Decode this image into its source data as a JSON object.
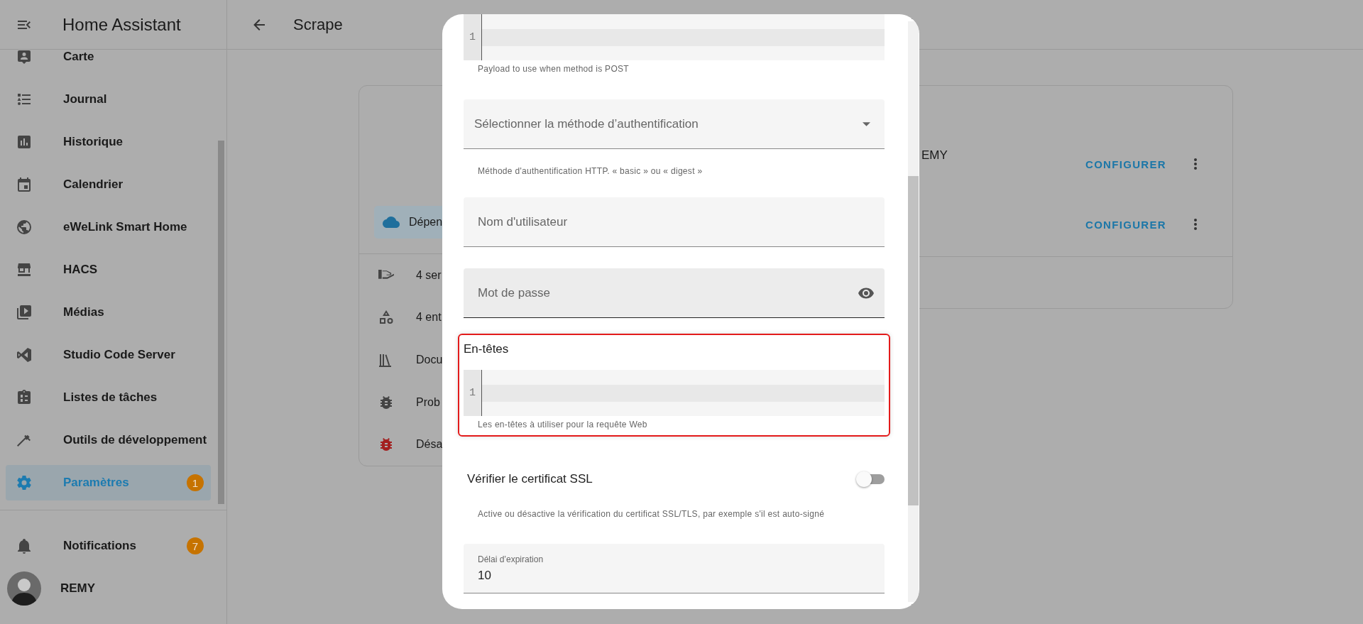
{
  "sidebar": {
    "title": "Home Assistant",
    "items": [
      {
        "label": "Carte",
        "selected": false
      },
      {
        "label": "Journal",
        "selected": false
      },
      {
        "label": "Historique",
        "selected": false
      },
      {
        "label": "Calendrier",
        "selected": false
      },
      {
        "label": "eWeLink Smart Home",
        "selected": false
      },
      {
        "label": "HACS",
        "selected": false
      },
      {
        "label": "Médias",
        "selected": false
      },
      {
        "label": "Studio Code Server",
        "selected": false
      },
      {
        "label": "Listes de tâches",
        "selected": false
      },
      {
        "label": "Outils de développement",
        "selected": false
      },
      {
        "label": "Paramètres",
        "selected": true,
        "badge": "1"
      }
    ],
    "notifications": {
      "label": "Notifications",
      "badge": "7"
    },
    "user": {
      "name": "REMY"
    }
  },
  "header": {
    "title": "Scrape"
  },
  "integration_card": {
    "chip": "Dépen",
    "links": [
      {
        "label": "4 ser"
      },
      {
        "label": "4 ent"
      },
      {
        "label": "Docu"
      },
      {
        "label": "Prob"
      },
      {
        "label": "Désa"
      }
    ]
  },
  "entries_card": {
    "entries": [
      {
        "title": "EMY",
        "action": "CONFIGURER"
      },
      {
        "action": "CONFIGURER"
      }
    ]
  },
  "dialog": {
    "fields": [
      {
        "kind": "code",
        "line_number": "1",
        "helper": "Payload to use when method is POST",
        "highlighted": false
      },
      {
        "kind": "select",
        "placeholder": "Sélectionner la méthode d’authentification",
        "helper": "Méthode d'authentification HTTP. « basic » ou « digest »"
      },
      {
        "kind": "text",
        "placeholder": "Nom d'utilisateur"
      },
      {
        "kind": "password",
        "placeholder": "Mot de passe"
      },
      {
        "kind": "code",
        "label": "En-têtes",
        "line_number": "1",
        "helper": "Les en-têtes à utiliser pour la requête Web",
        "highlighted": true
      },
      {
        "kind": "switch",
        "label": "Vérifier le certificat SSL",
        "on": false,
        "helper": "Active ou désactive la vérification du certificat SSL/TLS, par exemple s'il est auto-signé"
      },
      {
        "kind": "number",
        "label": "Délai d’expiration",
        "value": "10"
      }
    ]
  }
}
